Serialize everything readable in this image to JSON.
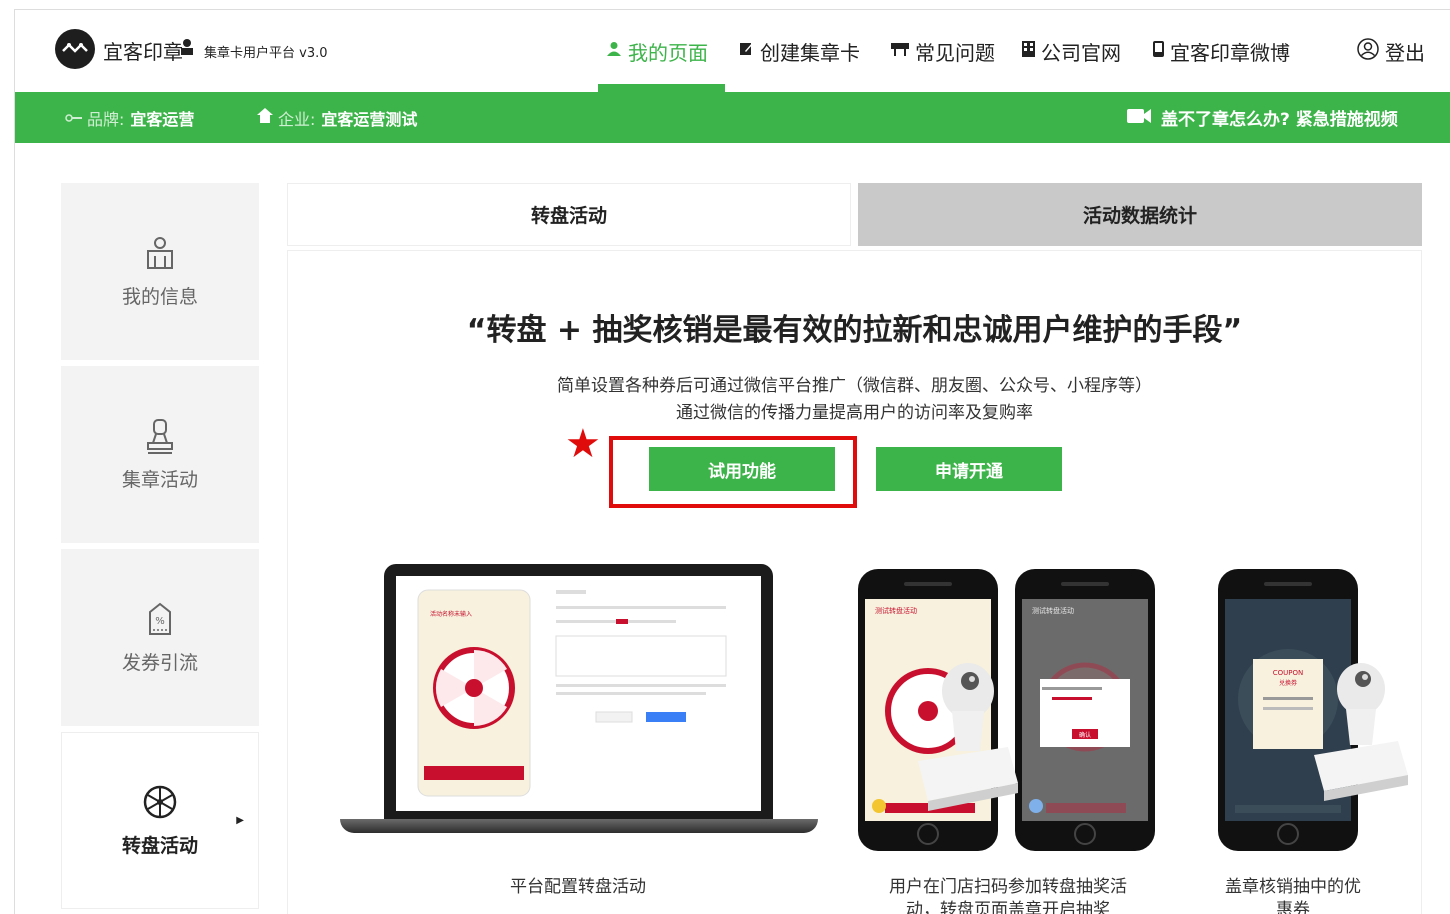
{
  "header": {
    "brand": "宜客印章",
    "brand_person_icon": "person-icon",
    "brand_sub": "集章卡用户平台 v3.0",
    "nav": [
      {
        "label": "我的页面",
        "icon": "user-icon"
      },
      {
        "label": "创建集章卡",
        "icon": "edit-icon"
      },
      {
        "label": "常见问题",
        "icon": "sign-icon"
      },
      {
        "label": "公司官网",
        "icon": "building-icon"
      },
      {
        "label": "宜客印章微博",
        "icon": "phone-icon"
      }
    ],
    "logout": "登出"
  },
  "greenbar": {
    "brand_prefix": "品牌:",
    "brand_value": "宜客运营",
    "company_prefix": "企业:",
    "company_value": "宜客运营测试",
    "video_link": "盖不了章怎么办? 紧急措施视频"
  },
  "sidebar": {
    "items": [
      {
        "label": "我的信息",
        "icon": "user-profile-icon"
      },
      {
        "label": "集章活动",
        "icon": "stamp-icon"
      },
      {
        "label": "发券引流",
        "icon": "coupon-icon"
      },
      {
        "label": "转盘活动",
        "icon": "wheel-icon"
      }
    ]
  },
  "tabs": {
    "active": "转盘活动",
    "inactive": "活动数据统计"
  },
  "content": {
    "headline": "“转盘 + 抽奖核销是最有效的拉新和忠诚用户维护的手段”",
    "sub1": "简单设置各种券后可通过微信平台推广（微信群、朋友圈、公众号、小程序等）",
    "sub2": "通过微信的传播力量提高用户的访问率及复购率",
    "try_button": "试用功能",
    "apply_button": "申请开通",
    "captions": [
      "平台配置转盘活动",
      "用户在门店扫码参加转盘抽奖活动，转盘页面盖章开启抽奖",
      "盖章核销抽中的优惠券"
    ],
    "phone1_title": "测试转盘活动",
    "phone2_title": "测试转盘活动",
    "coupon_text": "COUPON",
    "coupon_sub": "兑换券",
    "dialog_ok": "确认",
    "laptop_title": "活动名称未输入"
  },
  "colors": {
    "brand_green": "#3db44a",
    "highlight_red": "#e00c0c",
    "wheel_red": "#c8102e"
  }
}
